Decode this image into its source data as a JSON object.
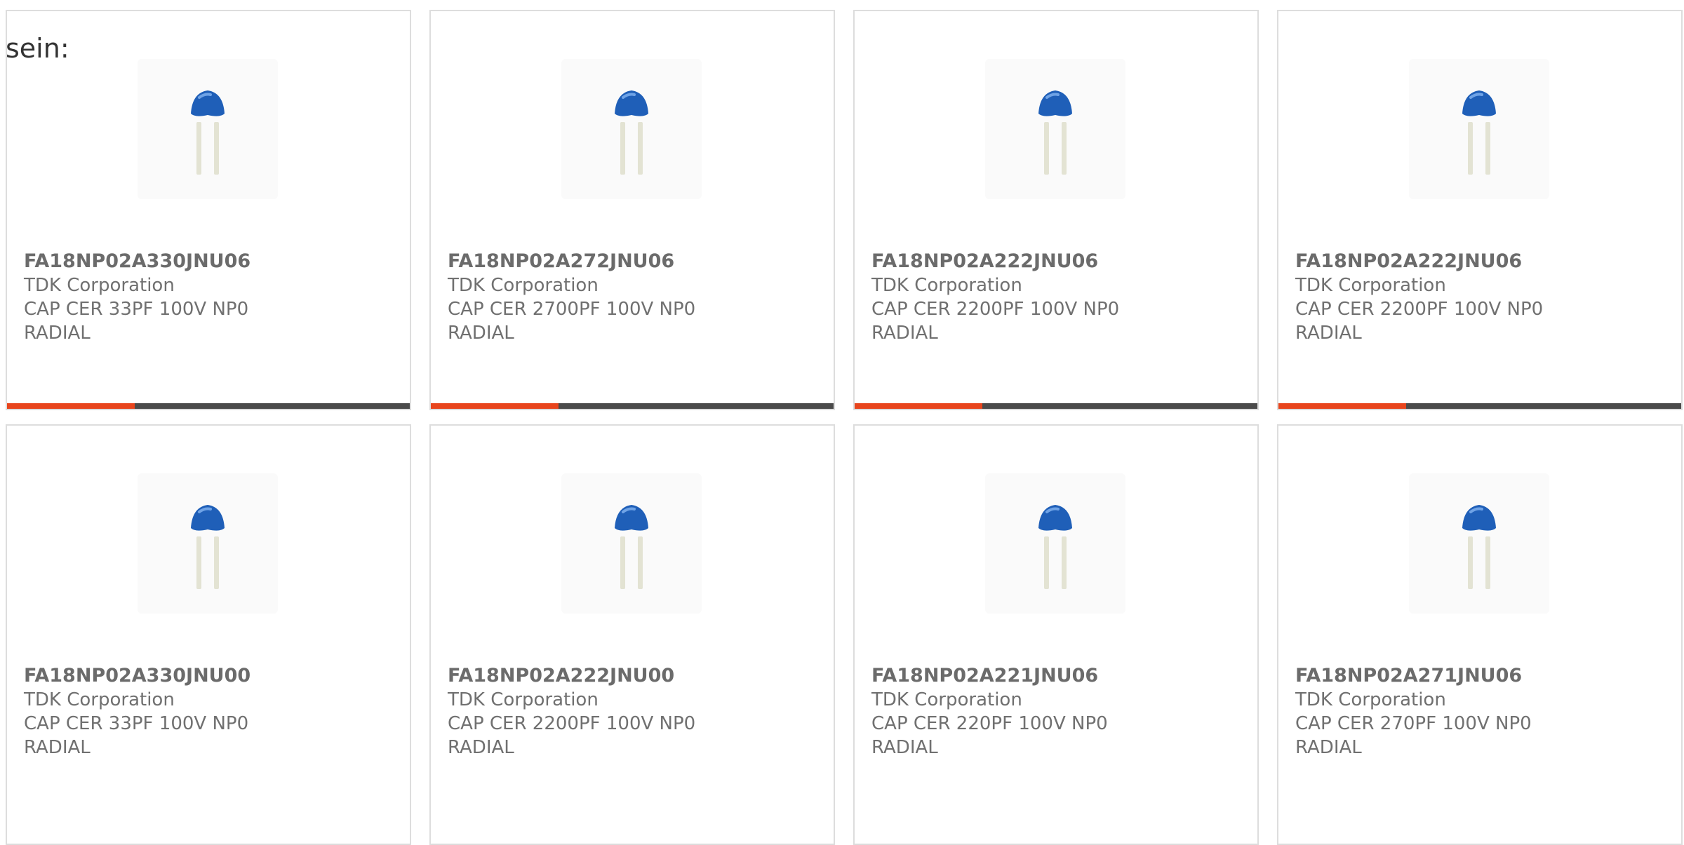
{
  "intro_text": "sein:",
  "colors": {
    "accent": "#e8451d",
    "bar": "#4a4a4a",
    "border": "#dddddd",
    "text": "#707070",
    "capacitor_body": "#1f5fb8"
  },
  "products": [
    {
      "part_number": "FA18NP02A330JNU06",
      "manufacturer": "TDK Corporation",
      "description": "CAP CER 33PF 100V NP0 RADIAL",
      "image_icon": "ceramic-capacitor-icon"
    },
    {
      "part_number": "FA18NP02A272JNU06",
      "manufacturer": "TDK Corporation",
      "description": "CAP CER 2700PF 100V NP0 RADIAL",
      "image_icon": "ceramic-capacitor-icon"
    },
    {
      "part_number": "FA18NP02A222JNU06",
      "manufacturer": "TDK Corporation",
      "description": "CAP CER 2200PF 100V NP0 RADIAL",
      "image_icon": "ceramic-capacitor-icon"
    },
    {
      "part_number": "FA18NP02A222JNU06",
      "manufacturer": "TDK Corporation",
      "description": "CAP CER 2200PF 100V NP0 RADIAL",
      "image_icon": "ceramic-capacitor-icon"
    },
    {
      "part_number": "FA18NP02A330JNU00",
      "manufacturer": "TDK Corporation",
      "description": "CAP CER 33PF 100V NP0 RADIAL",
      "image_icon": "ceramic-capacitor-icon"
    },
    {
      "part_number": "FA18NP02A222JNU00",
      "manufacturer": "TDK Corporation",
      "description": "CAP CER 2200PF 100V NP0 RADIAL",
      "image_icon": "ceramic-capacitor-icon"
    },
    {
      "part_number": "FA18NP02A221JNU06",
      "manufacturer": "TDK Corporation",
      "description": "CAP CER 220PF 100V NP0 RADIAL",
      "image_icon": "ceramic-capacitor-icon"
    },
    {
      "part_number": "FA18NP02A271JNU06",
      "manufacturer": "TDK Corporation",
      "description": "CAP CER 270PF 100V NP0 RADIAL",
      "image_icon": "ceramic-capacitor-icon"
    }
  ]
}
